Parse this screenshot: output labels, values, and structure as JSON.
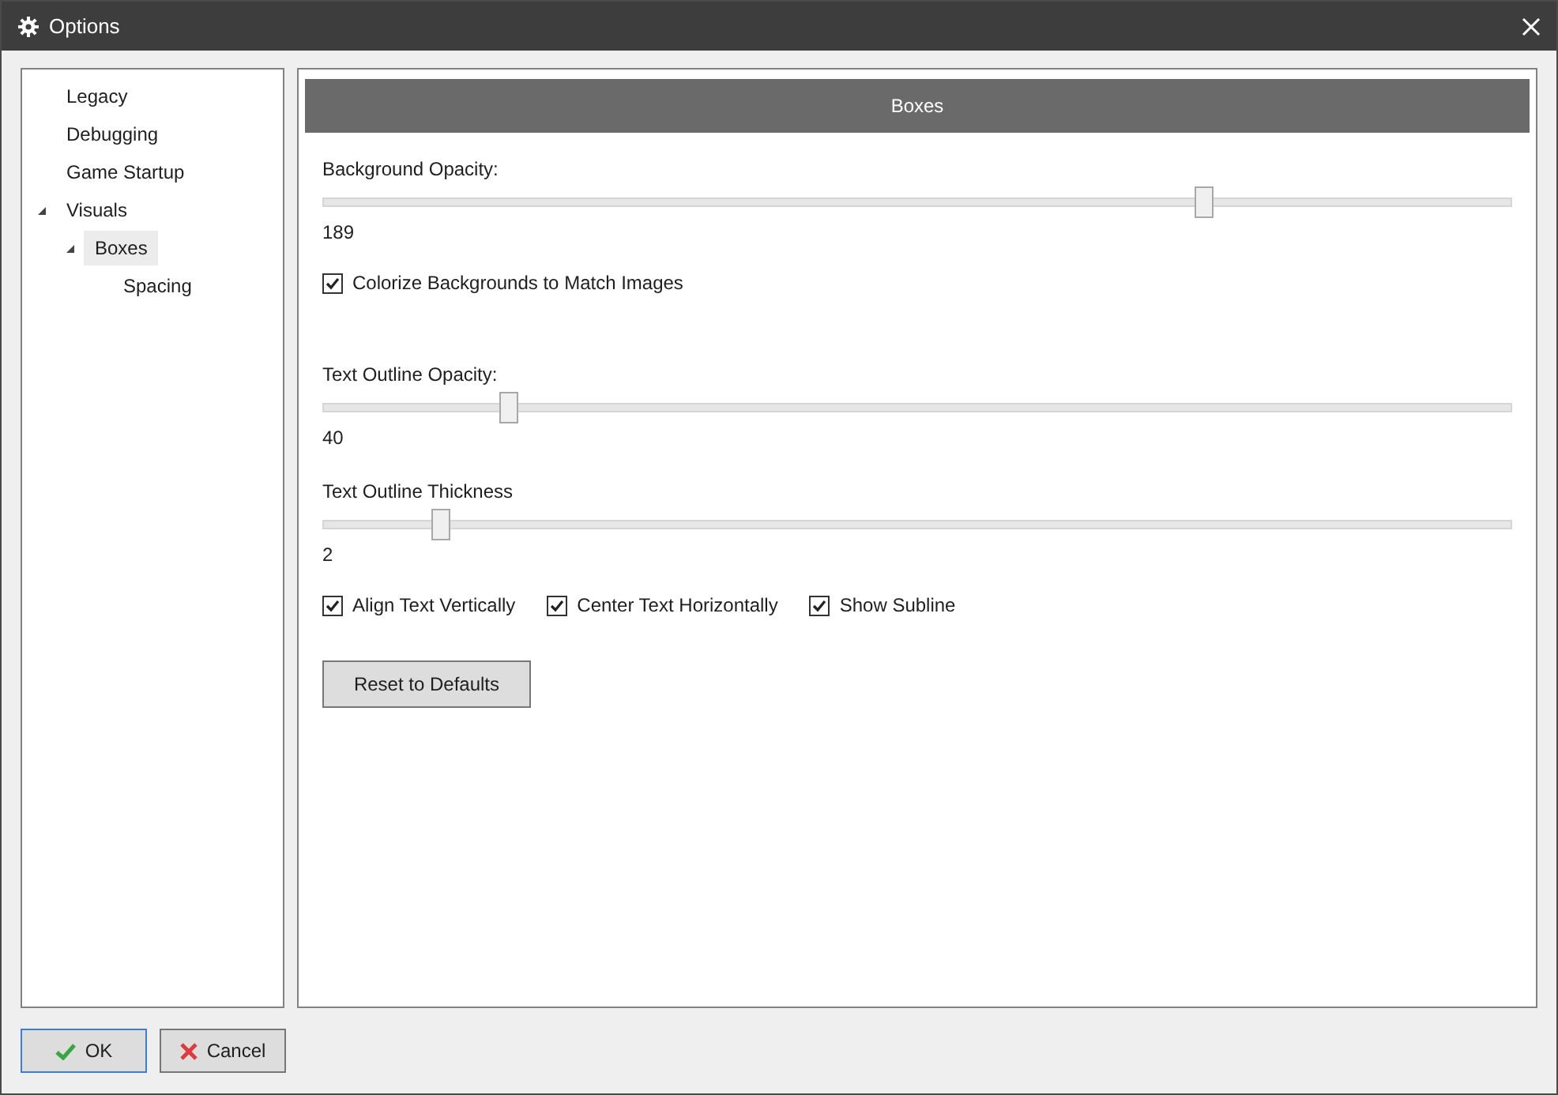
{
  "window": {
    "title": "Options"
  },
  "tree": [
    {
      "label": "Legacy",
      "selected": false
    },
    {
      "label": "Debugging",
      "selected": false
    },
    {
      "label": "Game Startup",
      "selected": false
    },
    {
      "label": "Visuals",
      "selected": false,
      "expanded": true,
      "children": [
        {
          "label": "Boxes",
          "selected": true,
          "expanded": true,
          "children": [
            {
              "label": "Spacing",
              "selected": false
            }
          ]
        }
      ]
    }
  ],
  "panel": {
    "title": "Boxes",
    "items": [
      {
        "kind": "slider",
        "label": "Background Opacity:",
        "level": 0.741,
        "reading": "189"
      },
      {
        "kind": "checkboxes",
        "options": [
          {
            "label": "Colorize Backgrounds to Match Images",
            "checked": true
          }
        ]
      },
      {
        "kind": "spacer"
      },
      {
        "kind": "slider",
        "label": "Text Outline Opacity:",
        "level": 0.157,
        "reading": "40"
      },
      {
        "kind": "slider",
        "label": "Text Outline Thickness",
        "level": 0.1,
        "reading": "2"
      },
      {
        "kind": "checkboxes",
        "options": [
          {
            "label": "Align Text Vertically",
            "checked": true
          },
          {
            "label": "Center Text Horizontally",
            "checked": true
          },
          {
            "label": "Show Subline",
            "checked": true
          }
        ]
      },
      {
        "kind": "button",
        "label": "Reset to Defaults"
      }
    ]
  },
  "buttons": [
    {
      "kind": "ok",
      "label": "OK",
      "focused": true
    },
    {
      "kind": "cancel",
      "label": "Cancel",
      "focused": false
    }
  ]
}
